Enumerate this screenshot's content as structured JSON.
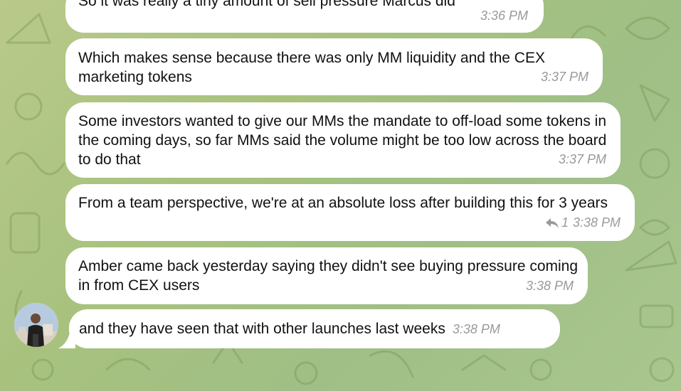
{
  "messages": [
    {
      "text": "So it was really a tiny amount of sell pressure Marcus did",
      "time": "3:36 PM"
    },
    {
      "text": "Which makes sense because there was only MM liquidity and the CEX marketing tokens",
      "time": "3:37 PM"
    },
    {
      "text": "Some investors wanted to give our MMs the mandate to off-load some tokens in the coming days, so far MMs said the volume might be too low across the board to do that",
      "time": "3:37 PM"
    },
    {
      "text": "From a team perspective, we're at an absolute loss after building this for 3 years",
      "time": "3:38 PM",
      "reply_count": "1"
    },
    {
      "text": "Amber came back yesterday saying they didn't see buying pressure coming in from CEX users",
      "time": "3:38 PM"
    },
    {
      "text": "and they have seen that with other launches last weeks",
      "time": "3:38 PM"
    }
  ],
  "colors": {
    "bubble": "#ffffff",
    "timestamp": "#9a9a9a",
    "text": "#111111"
  },
  "icons": {
    "reply": "reply-arrow-icon",
    "avatar": "sender-avatar"
  }
}
